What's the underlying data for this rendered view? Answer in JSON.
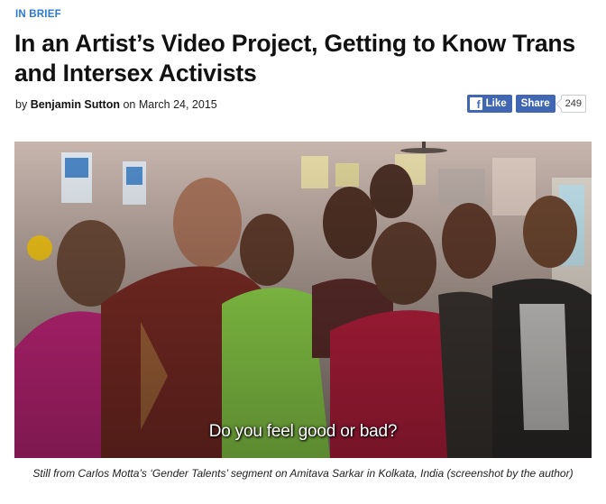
{
  "article": {
    "kicker": "IN BRIEF",
    "headline": "In an Artist’s Video Project, Getting to Know Trans and Intersex Activists",
    "byline": {
      "prefix": "by",
      "author": "Benjamin Sutton",
      "date_prefix": "on",
      "date": "March 24, 2015"
    }
  },
  "social": {
    "like_label": "Like",
    "share_label": "Share",
    "share_count": "249",
    "brand_color": "#4267b2"
  },
  "photo": {
    "subtitle": "Do you feel good or bad?",
    "caption": "Still from Carlos Motta’s ‘Gender Talents’ segment on Amitava Sarkar in Kolkata, India (screenshot by the author)"
  }
}
